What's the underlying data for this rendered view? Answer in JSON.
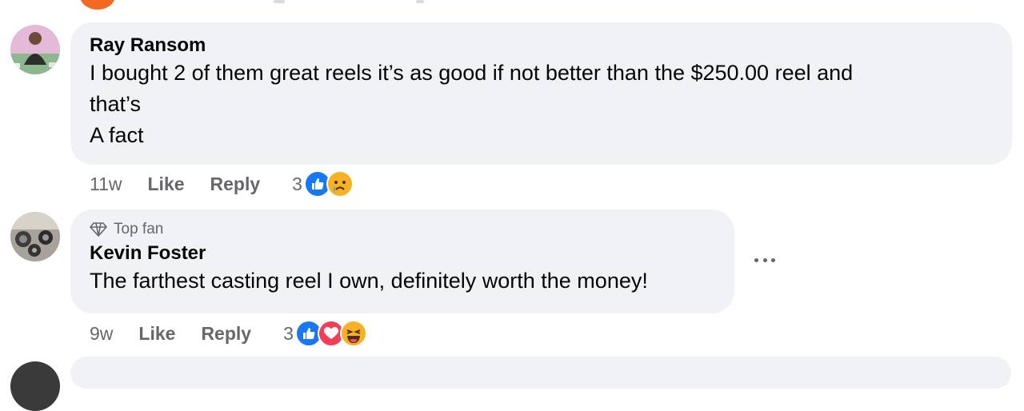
{
  "comments": [
    {
      "author": "Ray Ransom",
      "lines": [
        "I bought 2 of them great reels it’s as good if not better than the $250.00 reel and",
        "that’s",
        "A fact"
      ],
      "time": "11w",
      "like_label": "Like",
      "reply_label": "Reply",
      "reaction_count": "3",
      "reactions": [
        "like-icon",
        "sad-icon"
      ]
    },
    {
      "badge": "Top fan",
      "author": "Kevin Foster",
      "lines": [
        "The farthest casting reel I own, definitely worth the money!"
      ],
      "time": "9w",
      "like_label": "Like",
      "reply_label": "Reply",
      "reaction_count": "3",
      "reactions": [
        "like-icon",
        "love-icon",
        "haha-icon"
      ]
    }
  ],
  "colors": {
    "bubble": "#f0f2f5",
    "secondary_text": "#65676b",
    "like": "#1877f2",
    "love": "#f33e58",
    "emoji": "#f7b125"
  }
}
